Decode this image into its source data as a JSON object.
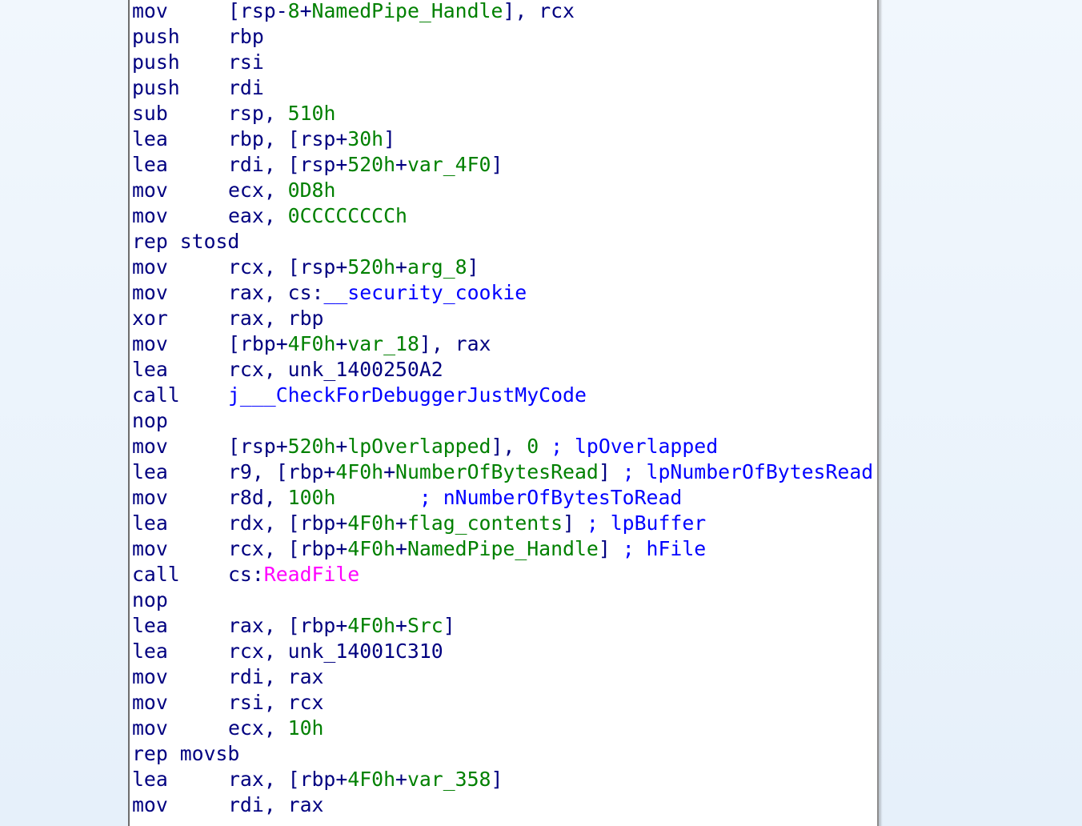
{
  "colors": {
    "background": "#eaf3fb",
    "panel": "#ffffff",
    "mnemonic": "#000080",
    "register": "#000080",
    "number": "#008000",
    "stack_var": "#008000",
    "code_reference": "#0000ff",
    "comment": "#0000ff",
    "import": "#ff00ff"
  },
  "lines": [
    {
      "mnemonic": "mov",
      "tokens": [
        {
          "t": "[rsp-",
          "c": "plain"
        },
        {
          "t": "8",
          "c": "num"
        },
        {
          "t": "+",
          "c": "plain"
        },
        {
          "t": "NamedPipe_Handle",
          "c": "name"
        },
        {
          "t": "], rcx",
          "c": "plain"
        }
      ]
    },
    {
      "mnemonic": "push",
      "tokens": [
        {
          "t": "rbp",
          "c": "plain"
        }
      ]
    },
    {
      "mnemonic": "push",
      "tokens": [
        {
          "t": "rsi",
          "c": "plain"
        }
      ]
    },
    {
      "mnemonic": "push",
      "tokens": [
        {
          "t": "rdi",
          "c": "plain"
        }
      ]
    },
    {
      "mnemonic": "sub",
      "tokens": [
        {
          "t": "rsp, ",
          "c": "plain"
        },
        {
          "t": "510h",
          "c": "num"
        }
      ]
    },
    {
      "mnemonic": "lea",
      "tokens": [
        {
          "t": "rbp, [rsp+",
          "c": "plain"
        },
        {
          "t": "30h",
          "c": "num"
        },
        {
          "t": "]",
          "c": "plain"
        }
      ]
    },
    {
      "mnemonic": "lea",
      "tokens": [
        {
          "t": "rdi, [rsp+",
          "c": "plain"
        },
        {
          "t": "520h",
          "c": "num"
        },
        {
          "t": "+",
          "c": "plain"
        },
        {
          "t": "var_4F0",
          "c": "name"
        },
        {
          "t": "]",
          "c": "plain"
        }
      ]
    },
    {
      "mnemonic": "mov",
      "tokens": [
        {
          "t": "ecx, ",
          "c": "plain"
        },
        {
          "t": "0D8h",
          "c": "num"
        }
      ]
    },
    {
      "mnemonic": "mov",
      "tokens": [
        {
          "t": "eax, ",
          "c": "plain"
        },
        {
          "t": "0CCCCCCCCh",
          "c": "num"
        }
      ]
    },
    {
      "mnemonic": "rep stosd",
      "wide": true,
      "tokens": []
    },
    {
      "mnemonic": "mov",
      "tokens": [
        {
          "t": "rcx, [rsp+",
          "c": "plain"
        },
        {
          "t": "520h",
          "c": "num"
        },
        {
          "t": "+",
          "c": "plain"
        },
        {
          "t": "arg_8",
          "c": "name"
        },
        {
          "t": "]",
          "c": "plain"
        }
      ]
    },
    {
      "mnemonic": "mov",
      "tokens": [
        {
          "t": "rax, cs:",
          "c": "plain"
        },
        {
          "t": "__security_cookie",
          "c": "ref"
        }
      ]
    },
    {
      "mnemonic": "xor",
      "tokens": [
        {
          "t": "rax, rbp",
          "c": "plain"
        }
      ]
    },
    {
      "mnemonic": "mov",
      "tokens": [
        {
          "t": "[rbp+",
          "c": "plain"
        },
        {
          "t": "4F0h",
          "c": "num"
        },
        {
          "t": "+",
          "c": "plain"
        },
        {
          "t": "var_18",
          "c": "name"
        },
        {
          "t": "], rax",
          "c": "plain"
        }
      ]
    },
    {
      "mnemonic": "lea",
      "tokens": [
        {
          "t": "rcx, unk_1400250A2",
          "c": "plain"
        }
      ]
    },
    {
      "mnemonic": "call",
      "tokens": [
        {
          "t": "j___CheckForDebuggerJustMyCode",
          "c": "ref"
        }
      ]
    },
    {
      "mnemonic": "nop",
      "tokens": []
    },
    {
      "mnemonic": "mov",
      "tokens": [
        {
          "t": "[rsp+",
          "c": "plain"
        },
        {
          "t": "520h",
          "c": "num"
        },
        {
          "t": "+",
          "c": "plain"
        },
        {
          "t": "lpOverlapped",
          "c": "name"
        },
        {
          "t": "], ",
          "c": "plain"
        },
        {
          "t": "0",
          "c": "num"
        },
        {
          "t": " ; lpOverlapped",
          "c": "comment"
        }
      ]
    },
    {
      "mnemonic": "lea",
      "tokens": [
        {
          "t": "r9, [rbp+",
          "c": "plain"
        },
        {
          "t": "4F0h",
          "c": "num"
        },
        {
          "t": "+",
          "c": "plain"
        },
        {
          "t": "NumberOfBytesRead",
          "c": "name"
        },
        {
          "t": "] ",
          "c": "plain"
        },
        {
          "t": "; lpNumberOfBytesRead",
          "c": "comment"
        }
      ]
    },
    {
      "mnemonic": "mov",
      "tokens": [
        {
          "t": "r8d, ",
          "c": "plain"
        },
        {
          "t": "100h",
          "c": "num"
        },
        {
          "t": "       ",
          "c": "plain"
        },
        {
          "t": "; nNumberOfBytesToRead",
          "c": "comment"
        }
      ]
    },
    {
      "mnemonic": "lea",
      "tokens": [
        {
          "t": "rdx, [rbp+",
          "c": "plain"
        },
        {
          "t": "4F0h",
          "c": "num"
        },
        {
          "t": "+",
          "c": "plain"
        },
        {
          "t": "flag_contents",
          "c": "name"
        },
        {
          "t": "] ",
          "c": "plain"
        },
        {
          "t": "; lpBuffer",
          "c": "comment"
        }
      ]
    },
    {
      "mnemonic": "mov",
      "tokens": [
        {
          "t": "rcx, [rbp+",
          "c": "plain"
        },
        {
          "t": "4F0h",
          "c": "num"
        },
        {
          "t": "+",
          "c": "plain"
        },
        {
          "t": "NamedPipe_Handle",
          "c": "name"
        },
        {
          "t": "] ",
          "c": "plain"
        },
        {
          "t": "; hFile",
          "c": "comment"
        }
      ]
    },
    {
      "mnemonic": "call",
      "tokens": [
        {
          "t": "cs:",
          "c": "plain"
        },
        {
          "t": "ReadFile",
          "c": "import"
        }
      ]
    },
    {
      "mnemonic": "nop",
      "tokens": []
    },
    {
      "mnemonic": "lea",
      "tokens": [
        {
          "t": "rax, [rbp+",
          "c": "plain"
        },
        {
          "t": "4F0h",
          "c": "num"
        },
        {
          "t": "+",
          "c": "plain"
        },
        {
          "t": "Src",
          "c": "name"
        },
        {
          "t": "]",
          "c": "plain"
        }
      ]
    },
    {
      "mnemonic": "lea",
      "tokens": [
        {
          "t": "rcx, unk_14001C310",
          "c": "plain"
        }
      ]
    },
    {
      "mnemonic": "mov",
      "tokens": [
        {
          "t": "rdi, rax",
          "c": "plain"
        }
      ]
    },
    {
      "mnemonic": "mov",
      "tokens": [
        {
          "t": "rsi, rcx",
          "c": "plain"
        }
      ]
    },
    {
      "mnemonic": "mov",
      "tokens": [
        {
          "t": "ecx, ",
          "c": "plain"
        },
        {
          "t": "10h",
          "c": "num"
        }
      ]
    },
    {
      "mnemonic": "rep movsb",
      "wide": true,
      "tokens": []
    },
    {
      "mnemonic": "lea",
      "tokens": [
        {
          "t": "rax, [rbp+",
          "c": "plain"
        },
        {
          "t": "4F0h",
          "c": "num"
        },
        {
          "t": "+",
          "c": "plain"
        },
        {
          "t": "var_358",
          "c": "name"
        },
        {
          "t": "]",
          "c": "plain"
        }
      ]
    },
    {
      "mnemonic": "mov",
      "tokens": [
        {
          "t": "rdi, rax",
          "c": "plain"
        }
      ]
    }
  ]
}
